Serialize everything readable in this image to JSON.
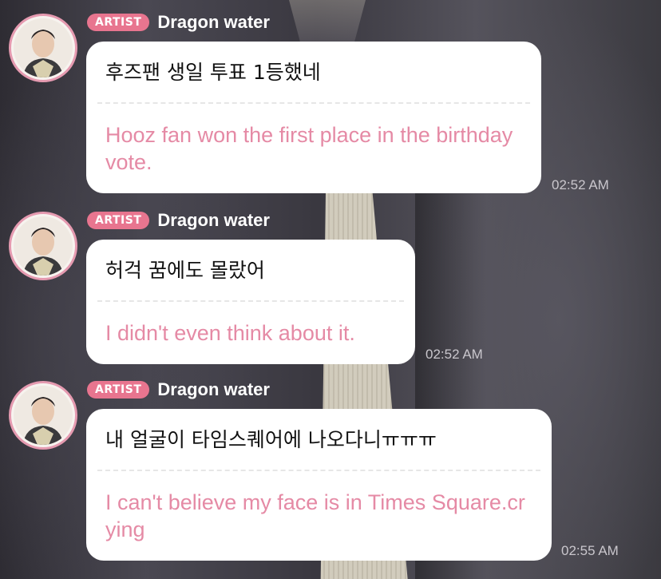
{
  "messages": [
    {
      "badge": "ARTIST",
      "sender": "Dragon water",
      "korean": "후즈팬 생일 투표 1등했네",
      "translation": "Hooz fan won the first place in the birthday vote.",
      "time": "02:52 AM"
    },
    {
      "badge": "ARTIST",
      "sender": "Dragon water",
      "korean": "허걱 꿈에도 몰랐어",
      "translation": "I didn't even think about it.",
      "time": "02:52 AM"
    },
    {
      "badge": "ARTIST",
      "sender": "Dragon water",
      "korean": "내 얼굴이 타임스퀘어에 나오다니ㅠㅠㅠ",
      "translation": "I can't believe my face is in Times Square.crying",
      "time": "02:55 AM"
    }
  ],
  "colors": {
    "badge": "#e8758f",
    "avatar_ring": "#e59ab0",
    "translation_text": "#e58aa5",
    "bubble": "#ffffff"
  }
}
